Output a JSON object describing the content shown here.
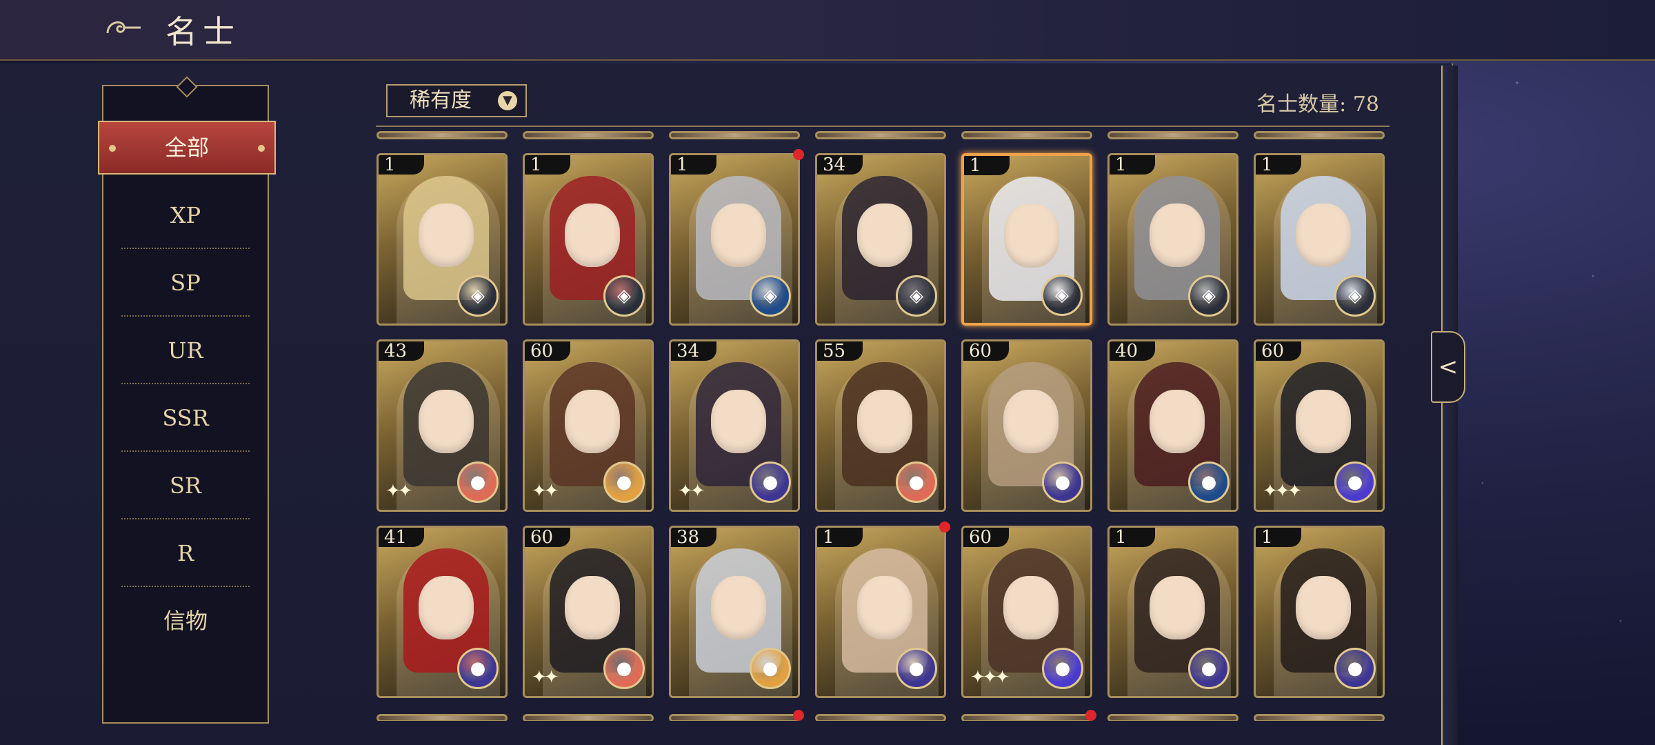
{
  "header": {
    "title": "名士",
    "emblem_icon": "cloud-swirl-icon"
  },
  "sidebar": {
    "filters": [
      {
        "label": "全部",
        "active": true
      },
      {
        "label": "XP"
      },
      {
        "label": "SP"
      },
      {
        "label": "UR"
      },
      {
        "label": "SSR"
      },
      {
        "label": "SR"
      },
      {
        "label": "R"
      },
      {
        "label": "信物"
      }
    ]
  },
  "toolbar": {
    "rarity_label": "稀有度",
    "rarity_icon": "chevron-down-icon",
    "count_label": "名士数量:",
    "count_value": "78"
  },
  "side_tab": {
    "icon": "arrow-left-icon",
    "glyph": "<"
  },
  "colors": {
    "accent_red": "#b8463e",
    "gold": "#a88f5c",
    "selected": "#f0a24a",
    "badge_gold": "#e2c88e"
  },
  "cards": [
    {
      "level": "1",
      "hair": "#d9c48a",
      "badge": "compass-icon",
      "badge_color": "#2a2e3a",
      "sparkles": "",
      "notify": false,
      "selected": false
    },
    {
      "level": "1",
      "hair": "#9b1f22",
      "badge": "compass-icon",
      "badge_color": "#2a2e3a",
      "sparkles": "",
      "notify": false,
      "selected": false
    },
    {
      "level": "1",
      "hair": "#b7b9c0",
      "badge": "compass-icon",
      "badge_color": "#1d4a8a",
      "sparkles": "",
      "notify": true,
      "selected": false
    },
    {
      "level": "34",
      "hair": "#2a2330",
      "badge": "compass-icon",
      "badge_color": "#2a2e3a",
      "sparkles": "",
      "notify": false,
      "selected": false
    },
    {
      "level": "1",
      "hair": "#e9e9ee",
      "badge": "compass-icon",
      "badge_color": "#2a2e3a",
      "sparkles": "",
      "notify": false,
      "selected": true
    },
    {
      "level": "1",
      "hair": "#8e8f95",
      "badge": "compass-icon",
      "badge_color": "#2a2e3a",
      "sparkles": "",
      "notify": false,
      "selected": false
    },
    {
      "level": "1",
      "hair": "#c9d6ea",
      "badge": "compass-icon",
      "badge_color": "#2a2e3a",
      "sparkles": "",
      "notify": false,
      "selected": false
    },
    {
      "level": "43",
      "hair": "#3a3530",
      "badge": "orb-icon",
      "badge_color": "#e06a55",
      "sparkles": "✦✦",
      "notify": false,
      "selected": false
    },
    {
      "level": "60",
      "hair": "#5a3424",
      "badge": "orb-icon",
      "badge_color": "#e2a040",
      "sparkles": "✦✦",
      "notify": false,
      "selected": false
    },
    {
      "level": "34",
      "hair": "#2e2538",
      "badge": "orb-icon",
      "badge_color": "#3d3592",
      "sparkles": "✦✦",
      "notify": false,
      "selected": false
    },
    {
      "level": "55",
      "hair": "#4a3020",
      "badge": "orb-icon",
      "badge_color": "#e06a55",
      "sparkles": "",
      "notify": false,
      "selected": false
    },
    {
      "level": "60",
      "hair": "#b39a7c",
      "badge": "orb-icon",
      "badge_color": "#3d3592",
      "sparkles": "",
      "notify": false,
      "selected": false
    },
    {
      "level": "40",
      "hair": "#4a1c1e",
      "badge": "orb-icon",
      "badge_color": "#1d4a8a",
      "sparkles": "",
      "notify": false,
      "selected": false
    },
    {
      "level": "60",
      "hair": "#1f1f25",
      "badge": "orb-icon",
      "badge_color": "#4a3ad0",
      "sparkles": "✦✦✦",
      "notify": false,
      "selected": false
    },
    {
      "level": "41",
      "hair": "#a8191c",
      "badge": "orb-icon",
      "badge_color": "#3d3592",
      "sparkles": "",
      "notify": false,
      "selected": false
    },
    {
      "level": "60",
      "hair": "#1e1c22",
      "badge": "orb-icon",
      "badge_color": "#e06a55",
      "sparkles": "✦✦",
      "notify": false,
      "selected": false
    },
    {
      "level": "38",
      "hair": "#c8ccd6",
      "badge": "orb-icon",
      "badge_color": "#e2a040",
      "sparkles": "",
      "notify": false,
      "selected": false
    },
    {
      "level": "1",
      "hair": "#d4b89e",
      "badge": "orb-icon",
      "badge_color": "#3d3592",
      "sparkles": "",
      "notify": true,
      "selected": false
    },
    {
      "level": "60",
      "hair": "#4a3126",
      "badge": "orb-icon",
      "badge_color": "#4a3ad0",
      "sparkles": "✦✦✦",
      "notify": false,
      "selected": false
    },
    {
      "level": "1",
      "hair": "#2e221e",
      "badge": "orb-icon",
      "badge_color": "#3d3592",
      "sparkles": "",
      "notify": false,
      "selected": false
    },
    {
      "level": "1",
      "hair": "#241c1a",
      "badge": "orb-icon",
      "badge_color": "#3d3592",
      "sparkles": "",
      "notify": false,
      "selected": false
    }
  ]
}
